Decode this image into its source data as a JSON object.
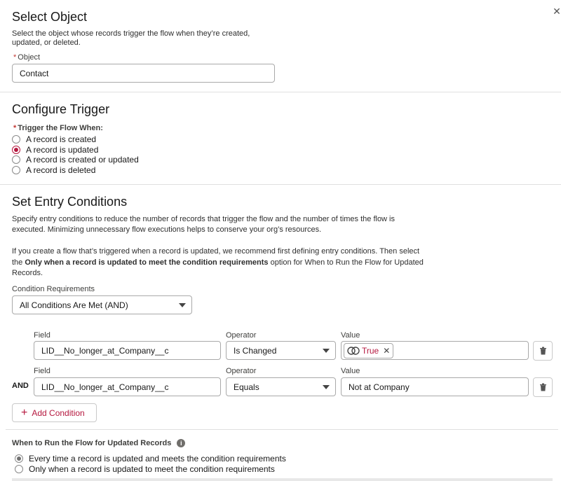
{
  "select_object": {
    "title": "Select Object",
    "description_line1": "Select the object whose records trigger the flow when they’re created,",
    "description_line2": "updated, or deleted.",
    "object_label": "Object",
    "object_value": "Contact"
  },
  "configure_trigger": {
    "title": "Configure Trigger",
    "label": "Trigger the Flow When:",
    "options": [
      {
        "label": "A record is created",
        "checked": false
      },
      {
        "label": "A record is updated",
        "checked": true
      },
      {
        "label": "A record is created or updated",
        "checked": false
      },
      {
        "label": "A record is deleted",
        "checked": false
      }
    ]
  },
  "entry_conditions": {
    "title": "Set Entry Conditions",
    "desc1_line1": "Specify entry conditions to reduce the number of records that trigger the flow and the number of times the flow is",
    "desc1_line2": "executed. Minimizing unnecessary flow executions helps to conserve your org’s resources.",
    "desc2_line1": "If you create a flow that’s triggered when a record is updated, we recommend first defining entry conditions. Then select",
    "desc2_line2_pre": "the ",
    "desc2_line2_bold": "Only when a record is updated to meet the condition requirements",
    "desc2_line2_post": " option for When to Run the Flow for Updated",
    "desc2_line3": "Records.",
    "requirements_label": "Condition Requirements",
    "requirements_value": "All Conditions Are Met (AND)",
    "field_label": "Field",
    "operator_label": "Operator",
    "value_label": "Value",
    "and_label": "AND",
    "conditions": [
      {
        "field": "LID__No_longer_at_Company__c",
        "operator": "Is Changed",
        "value": "True"
      },
      {
        "field": "LID__No_longer_at_Company__c",
        "operator": "Equals",
        "value": "Not at Company"
      }
    ],
    "add_condition": "Add Condition"
  },
  "when_to_run": {
    "title": "When to Run the Flow for Updated Records",
    "options": [
      {
        "label": "Every time a record is updated and meets the condition requirements",
        "checked": true
      },
      {
        "label": "Only when a record is updated to meet the condition requirements",
        "checked": false
      }
    ]
  },
  "colors": {
    "accent": "#b5183f",
    "border": "#a9a9a9",
    "divider": "#e0e0e0"
  }
}
